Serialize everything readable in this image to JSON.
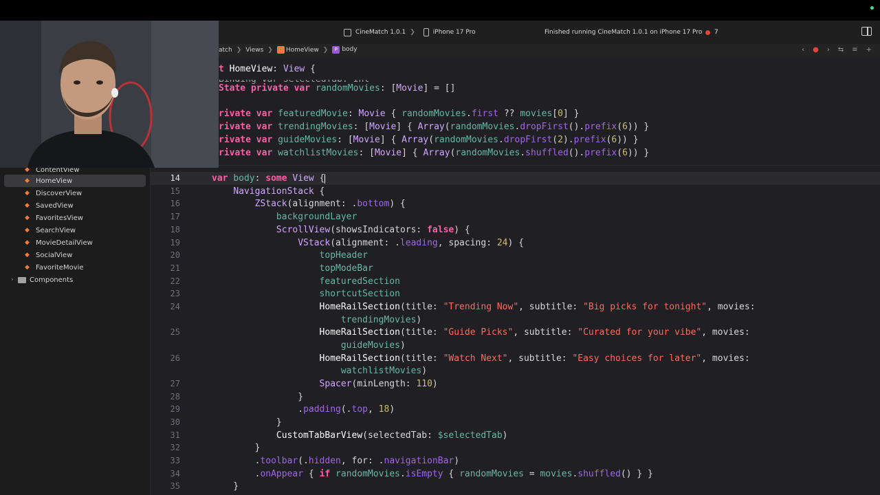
{
  "toolbar": {
    "scheme": "CineMatch 1.0.1",
    "destination": "iPhone 17 Pro",
    "status": "Finished running CineMatch 1.0.1 on iPhone 17 Pro",
    "error_count": "7"
  },
  "jumpbar": {
    "crumbs": [
      "atch",
      "Views",
      "HomeView",
      "body"
    ]
  },
  "sidebar": {
    "items": [
      {
        "label": "ContentView"
      },
      {
        "label": "HomeView"
      },
      {
        "label": "DiscoverView"
      },
      {
        "label": "SavedView"
      },
      {
        "label": "FavoritesView"
      },
      {
        "label": "SearchView"
      },
      {
        "label": "MovieDetailView"
      },
      {
        "label": "SocialView"
      },
      {
        "label": "FavoriteMovie"
      }
    ],
    "folder": "Components",
    "selected": "HomeView"
  },
  "sticky_header": [
    "t HomeView: View {",
    "Binding var selectedTab: Int",
    "State private var randomMovies: [Movie] = []",
    "rivate var featuredMovie: Movie { randomMovies.first ?? movies[0] }",
    "rivate var trendingMovies: [Movie] { Array(randomMovies.dropFirst().prefix(6)) }",
    "rivate var guideMovies: [Movie] { Array(randomMovies.dropFirst(2).prefix(6)) }",
    "rivate var watchlistMovies: [Movie] { Array(randomMovies.shuffled().prefix(6)) }"
  ],
  "editor": {
    "current_line": "14",
    "lines": [
      {
        "n": "14",
        "text": "var body: some View {"
      },
      {
        "n": "15",
        "text": "    NavigationStack {"
      },
      {
        "n": "16",
        "text": "        ZStack(alignment: .bottom) {"
      },
      {
        "n": "17",
        "text": "            backgroundLayer"
      },
      {
        "n": "18",
        "text": "            ScrollView(showsIndicators: false) {"
      },
      {
        "n": "19",
        "text": "                VStack(alignment: .leading, spacing: 24) {"
      },
      {
        "n": "20",
        "text": "                    topHeader"
      },
      {
        "n": "21",
        "text": "                    topModeBar"
      },
      {
        "n": "22",
        "text": "                    featuredSection"
      },
      {
        "n": "23",
        "text": "                    shortcutSection"
      },
      {
        "n": "24",
        "text": "                    HomeRailSection(title: \"Trending Now\", subtitle: \"Big picks for tonight\", movies:"
      },
      {
        "n": "",
        "text": "                        trendingMovies)"
      },
      {
        "n": "25",
        "text": "                    HomeRailSection(title: \"Guide Picks\", subtitle: \"Curated for your vibe\", movies:"
      },
      {
        "n": "",
        "text": "                        guideMovies)"
      },
      {
        "n": "26",
        "text": "                    HomeRailSection(title: \"Watch Next\", subtitle: \"Easy choices for later\", movies:"
      },
      {
        "n": "",
        "text": "                        watchlistMovies)"
      },
      {
        "n": "27",
        "text": "                    Spacer(minLength: 110)"
      },
      {
        "n": "28",
        "text": "                }"
      },
      {
        "n": "29",
        "text": "                .padding(.top, 18)"
      },
      {
        "n": "30",
        "text": "            }"
      },
      {
        "n": "31",
        "text": "            CustomTabBarView(selectedTab: $selectedTab)"
      },
      {
        "n": "32",
        "text": "        }"
      },
      {
        "n": "33",
        "text": "        .toolbar(.hidden, for: .navigationBar)"
      },
      {
        "n": "34",
        "text": "        .onAppear { if randomMovies.isEmpty { randomMovies = movies.shuffled() } }"
      },
      {
        "n": "35",
        "text": "    }"
      }
    ]
  },
  "colors": {
    "keyword": "#fc5fa3",
    "type": "#d0a8ff",
    "property": "#67b7a4",
    "string": "#fc6a5d",
    "number": "#d0bf69",
    "error": "#e0453e",
    "swift_icon": "#f27a3f"
  }
}
